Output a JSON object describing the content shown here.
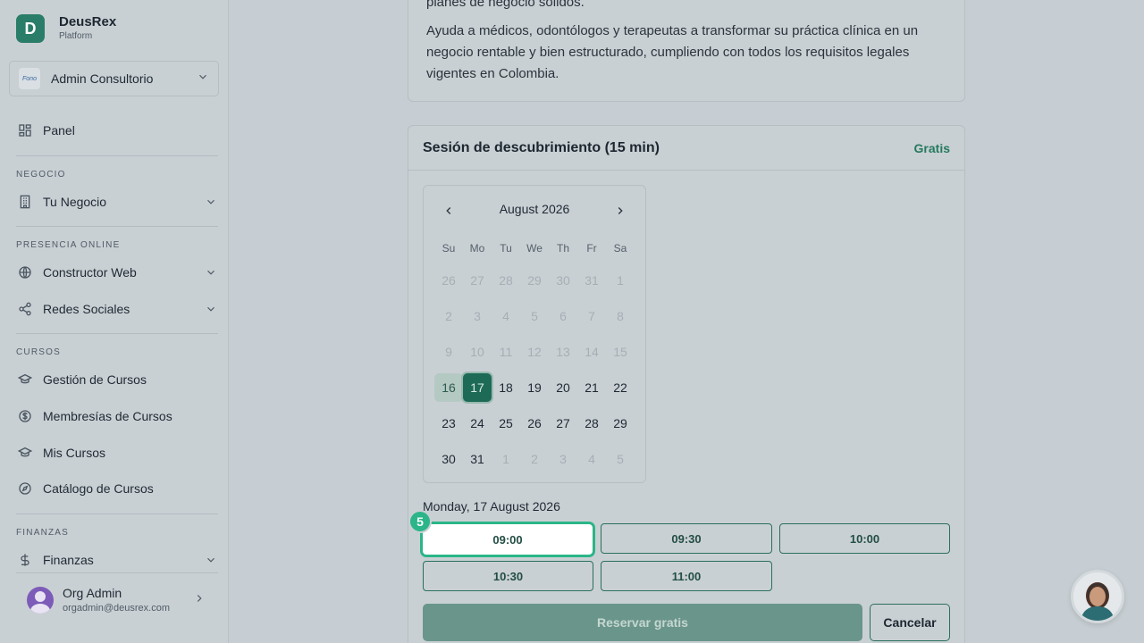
{
  "brand": {
    "initial": "D",
    "name": "DeusRex",
    "subtitle": "Platform"
  },
  "org": {
    "logo_text": "Fono",
    "name": "Admin Consultorio"
  },
  "nav": {
    "panel": "Panel",
    "sections": {
      "negocio": "NEGOCIO",
      "presencia": "PRESENCIA ONLINE",
      "cursos": "CURSOS",
      "finanzas": "FINANZAS"
    },
    "items": {
      "tu_negocio": "Tu Negocio",
      "constructor_web": "Constructor Web",
      "redes_sociales": "Redes Sociales",
      "gestion_cursos": "Gestión de Cursos",
      "membresias": "Membresías de Cursos",
      "mis_cursos": "Mis Cursos",
      "catalogo": "Catálogo de Cursos",
      "finanzas": "Finanzas"
    }
  },
  "user": {
    "name": "Org Admin",
    "email": "orgadmin@deusrex.com"
  },
  "description": {
    "line_top": "planes de negocio sólidos.",
    "paragraph": "Ayuda a médicos, odontólogos y terapeutas a transformar su práctica clínica en un negocio rentable y bien estructurado, cumpliendo con todos los requisitos legales vigentes en Colombia."
  },
  "booking": {
    "title": "Sesión de descubrimiento (15 min)",
    "price_badge": "Gratis",
    "calendar": {
      "month_label": "August 2026",
      "weekdays": [
        "Su",
        "Mo",
        "Tu",
        "We",
        "Th",
        "Fr",
        "Sa"
      ],
      "weeks": [
        [
          "26",
          "27",
          "28",
          "29",
          "30",
          "31",
          "1"
        ],
        [
          "2",
          "3",
          "4",
          "5",
          "6",
          "7",
          "8"
        ],
        [
          "9",
          "10",
          "11",
          "12",
          "13",
          "14",
          "15"
        ],
        [
          "16",
          "17",
          "18",
          "19",
          "20",
          "21",
          "22"
        ],
        [
          "23",
          "24",
          "25",
          "26",
          "27",
          "28",
          "29"
        ],
        [
          "30",
          "31",
          "1",
          "2",
          "3",
          "4",
          "5"
        ]
      ],
      "today": "16",
      "selected": "17"
    },
    "selected_date_label": "Monday, 17 August 2026",
    "time_slots": [
      "09:00",
      "09:30",
      "10:00",
      "10:30",
      "11:00"
    ],
    "active_slot": "09:00",
    "step_number": "5",
    "submit_label": "Reservar gratis",
    "cancel_label": "Cancelar"
  },
  "colors": {
    "accent": "#1d6b56",
    "step_badge": "#2bb588",
    "badge_text": "#257a5d"
  }
}
